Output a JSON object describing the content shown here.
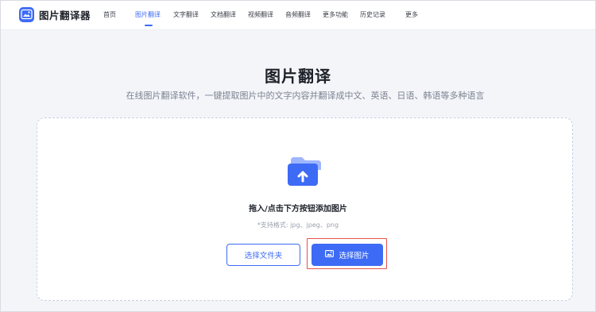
{
  "header": {
    "logo_text": "图片翻译器",
    "nav": [
      {
        "label": "首页",
        "active": false
      },
      {
        "label": "图片翻译",
        "active": true
      },
      {
        "label": "文字翻译",
        "active": false
      },
      {
        "label": "文档翻译",
        "active": false
      },
      {
        "label": "视频翻译",
        "active": false
      },
      {
        "label": "音频翻译",
        "active": false
      },
      {
        "label": "更多功能",
        "active": false
      },
      {
        "label": "历史记录",
        "active": false
      },
      {
        "label": "更多",
        "active": false
      }
    ]
  },
  "hero": {
    "title": "图片翻译",
    "subtitle": "在线图片翻译软件，一键提取图片中的文字内容并翻译成中文、英语、日语、韩语等多种语言"
  },
  "upload": {
    "drop_text": "拖入/点击下方按钮添加图片",
    "formats": "*支持格式: jpg、jpeg、png",
    "folder_button": "选择文件夹",
    "image_button": "选择图片",
    "icon": "folder-upload-icon"
  },
  "colors": {
    "accent": "#3d6bf5",
    "highlight_border": "#e6514c",
    "background": "#f4f5f9"
  }
}
